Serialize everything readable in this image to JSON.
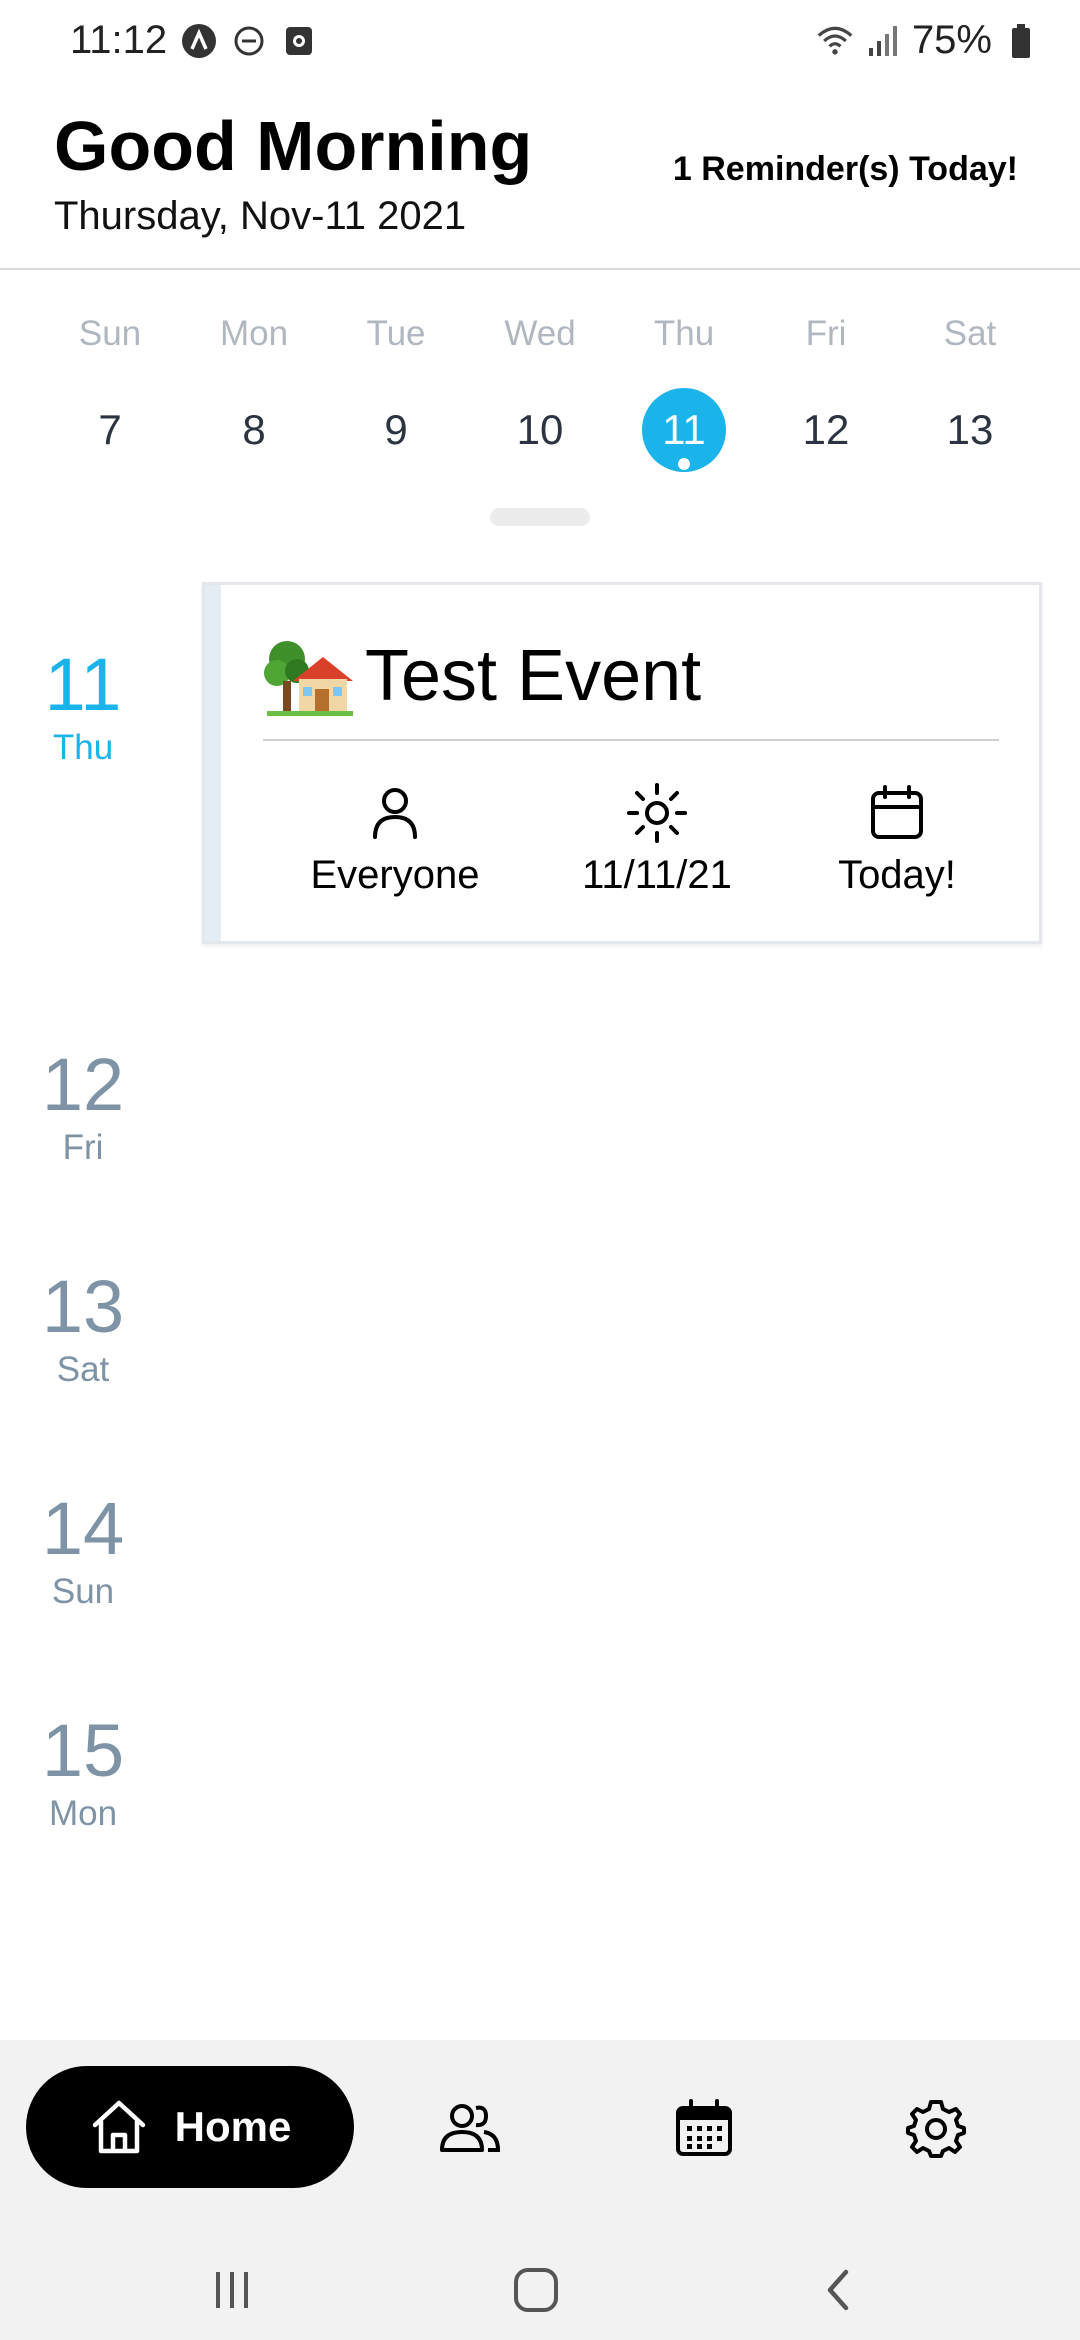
{
  "status_bar": {
    "time": "11:12",
    "battery_text": "75%",
    "icons": [
      "app-a-icon",
      "dnd-icon",
      "screen-record-icon",
      "wifi-icon",
      "signal-icon",
      "battery-icon"
    ]
  },
  "header": {
    "greeting": "Good Morning",
    "date": "Thursday, Nov-11 2021",
    "reminder": "1 Reminder(s) Today!"
  },
  "week": {
    "days": [
      {
        "name": "Sun",
        "num": "7"
      },
      {
        "name": "Mon",
        "num": "8"
      },
      {
        "name": "Tue",
        "num": "9"
      },
      {
        "name": "Wed",
        "num": "10"
      },
      {
        "name": "Thu",
        "num": "11"
      },
      {
        "name": "Fri",
        "num": "12"
      },
      {
        "name": "Sat",
        "num": "13"
      }
    ],
    "selected": "11",
    "accent_color": "#1ab3ea"
  },
  "agenda": {
    "days": [
      {
        "num": "11",
        "name": "Thu"
      },
      {
        "num": "12",
        "name": "Fri"
      },
      {
        "num": "13",
        "name": "Sat"
      },
      {
        "num": "14",
        "name": "Sun"
      },
      {
        "num": "15",
        "name": "Mon"
      }
    ]
  },
  "event": {
    "emoji_icon": "house-with-garden-icon",
    "title": "Test Event",
    "audience": "Everyone",
    "date": "11/11/21",
    "when": "Today!"
  },
  "nav": {
    "home_label": "Home",
    "items": [
      "home-icon",
      "people-icon",
      "calendar-icon",
      "settings-icon"
    ]
  },
  "system_nav": [
    "recents-icon",
    "home-circle-icon",
    "back-icon"
  ]
}
